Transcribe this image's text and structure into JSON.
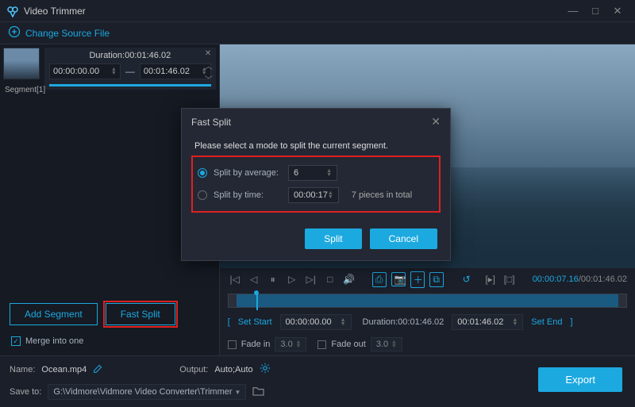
{
  "app": {
    "title": "Video Trimmer"
  },
  "toolbar": {
    "change_source": "Change Source File"
  },
  "segment": {
    "name": "Segment[1]",
    "duration_label": "Duration:00:01:46.02",
    "start": "00:00:00.00",
    "end": "00:01:46.02"
  },
  "buttons": {
    "add_segment": "Add Segment",
    "fast_split": "Fast Split",
    "merge": "Merge into one"
  },
  "playback": {
    "current": "00:00:07.16",
    "total": "00:01:46.02"
  },
  "range": {
    "set_start": "Set Start",
    "start_val": "00:00:00.00",
    "duration_label": "Duration:00:01:46.02",
    "end_val": "00:01:46.02",
    "set_end": "Set End"
  },
  "fade": {
    "in_label": "Fade in",
    "in_val": "3.0",
    "out_label": "Fade out",
    "out_val": "3.0"
  },
  "footer": {
    "name_label": "Name:",
    "name_val": "Ocean.mp4",
    "output_label": "Output:",
    "output_val": "Auto;Auto",
    "save_label": "Save to:",
    "save_val": "G:\\Vidmore\\Vidmore Video Converter\\Trimmer",
    "export": "Export"
  },
  "dialog": {
    "title": "Fast Split",
    "prompt": "Please select a mode to split the current segment.",
    "opt_avg_label": "Split by average:",
    "opt_avg_val": "6",
    "opt_time_label": "Split by time:",
    "opt_time_val": "00:00:17",
    "pieces_hint": "7 pieces in total",
    "split_btn": "Split",
    "cancel_btn": "Cancel"
  }
}
